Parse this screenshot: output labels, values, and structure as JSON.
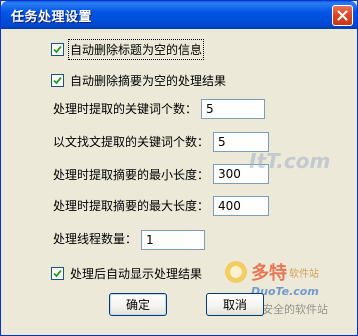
{
  "window": {
    "title": "任务处理设置"
  },
  "options": {
    "auto_delete_empty_title": {
      "label": "自动删除标题为空的信息",
      "checked": true
    },
    "auto_delete_empty_summary": {
      "label": "自动删除摘要为空的处理结果",
      "checked": true
    },
    "auto_show_results": {
      "label": "处理后自动显示处理结果",
      "checked": true
    }
  },
  "fields": {
    "keyword_count_extract": {
      "label": "处理时提取的关键词个数：",
      "value": "5"
    },
    "keyword_count_text": {
      "label": "以文找文提取的关键词个数：",
      "value": "5"
    },
    "summary_min_length": {
      "label": "处理时提取摘要的最小长度：",
      "value": "300"
    },
    "summary_max_length": {
      "label": "处理时提取摘要的最大长度：",
      "value": "400"
    },
    "thread_count": {
      "label": "处理线程数量：",
      "value": "1"
    }
  },
  "buttons": {
    "ok": "确定",
    "cancel": "取消"
  },
  "watermark": {
    "brand": "多特",
    "brand_suffix": "软件站",
    "site": "DuoTe.com",
    "slogan": "最安全的软件站",
    "center_mark": "ItT.com"
  },
  "colors": {
    "title_bar": "#0055e5",
    "window_bg": "#ece9d8",
    "close": "#d9461f"
  }
}
